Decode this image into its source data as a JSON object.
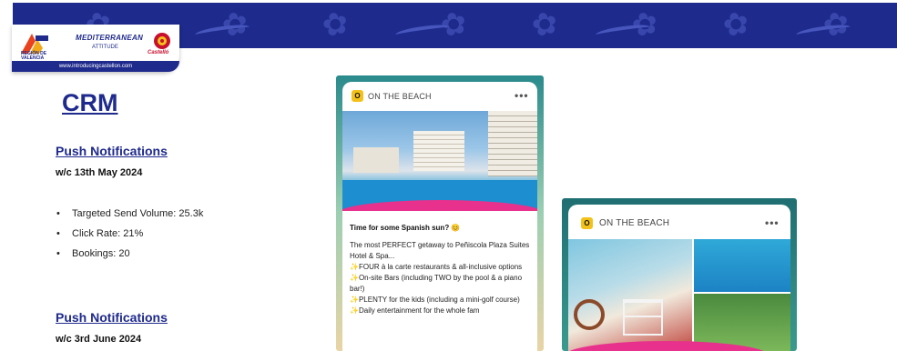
{
  "logo": {
    "cv_text": "REGIÓN DE VALENCIA",
    "med_text": "MEDITERRANEAN",
    "att_text": "ATTITUDE",
    "cs_text": "Castelló",
    "url": "www.introducingcastellon.com"
  },
  "page": {
    "title": "CRM"
  },
  "sections": [
    {
      "heading": "Push Notifications",
      "date": "w/c 13th May 2024",
      "stats": [
        "Targeted Send Volume: 25.3k",
        "Click Rate: 21%",
        "Bookings: 20"
      ]
    },
    {
      "heading": "Push Notifications",
      "date": "w/c 3rd June 2024"
    }
  ],
  "notifications": [
    {
      "app_icon": "O",
      "app_name": "ON THE BEACH",
      "more": "•••",
      "title": "Time for some Spanish sun? 😊",
      "body": [
        "The most PERFECT getaway to Peñiscola Plaza Suites Hotel & Spa...",
        "✨FOUR à la carte restaurants & all-inclusive options",
        "✨On-site Bars (including TWO by the pool & a piano bar!)",
        "✨PLENTY for the kids (including a mini-golf course)",
        "✨Daily entertainment for the whole fam"
      ]
    },
    {
      "app_icon": "O",
      "app_name": "ON THE BEACH",
      "more": "•••"
    }
  ],
  "colors": {
    "brand_blue": "#1e2a8c",
    "pink_wave": "#e8318c",
    "app_icon_yellow": "#f2c21b"
  }
}
